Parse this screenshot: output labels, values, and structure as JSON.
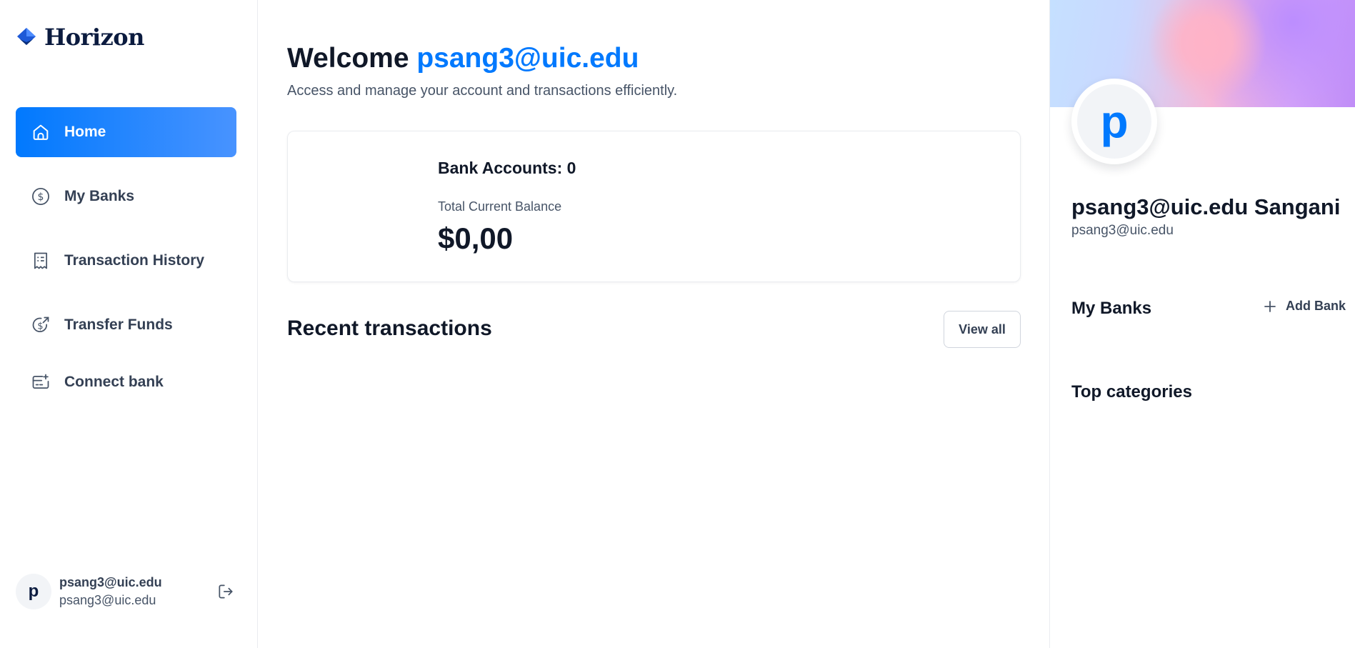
{
  "app": {
    "name": "Horizon",
    "accent": "#0179fe"
  },
  "sidebar": {
    "items": [
      {
        "label": "Home",
        "icon": "home-icon",
        "active": true
      },
      {
        "label": "My Banks",
        "icon": "dollar-circle-icon",
        "active": false
      },
      {
        "label": "Transaction History",
        "icon": "receipt-icon",
        "active": false
      },
      {
        "label": "Transfer Funds",
        "icon": "money-send-icon",
        "active": false
      },
      {
        "label": "Connect bank",
        "icon": "card-add-icon",
        "active": false
      }
    ],
    "user": {
      "initial": "p",
      "name": "psang3@uic.edu",
      "email": "psang3@uic.edu"
    }
  },
  "main": {
    "welcome_prefix": "Welcome",
    "welcome_user": "psang3@uic.edu",
    "subtext": "Access and manage your account and transactions efficiently.",
    "balance": {
      "accounts_label": "Bank Accounts: 0",
      "total_label": "Total Current Balance",
      "total_value": "$0,00"
    },
    "recent": {
      "title": "Recent transactions",
      "view_all": "View all"
    }
  },
  "right": {
    "avatar_initial": "p",
    "name": "psang3@uic.edu Sangani",
    "email": "psang3@uic.edu",
    "my_banks_title": "My Banks",
    "add_bank_label": "Add Bank",
    "top_categories_title": "Top categories"
  }
}
